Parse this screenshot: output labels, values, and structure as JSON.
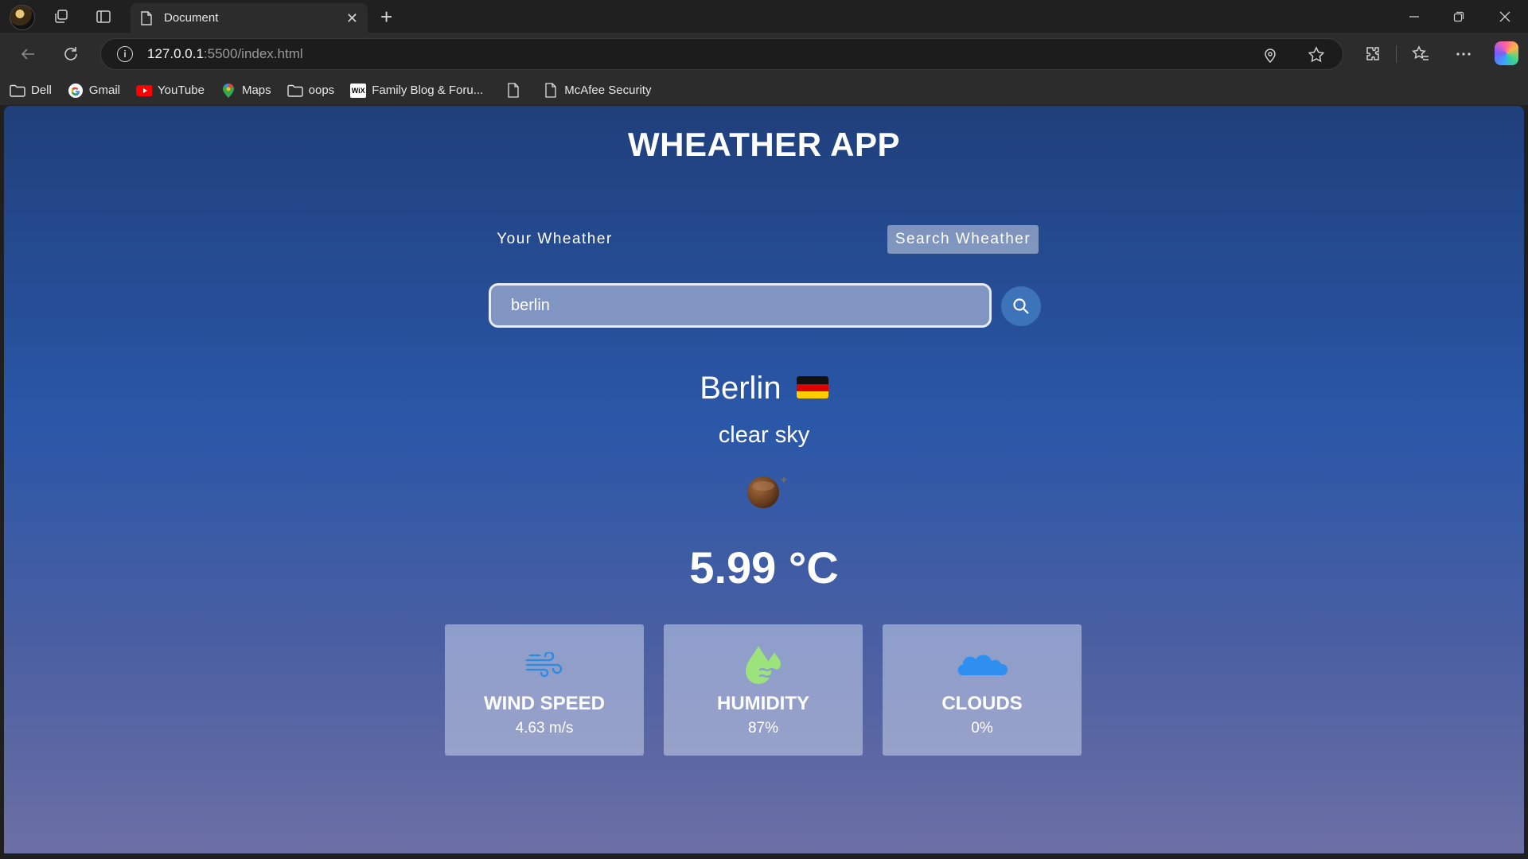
{
  "browser": {
    "tab_title": "Document",
    "address": {
      "host": "127.0.0.1",
      "path": ":5500/index.html"
    },
    "bookmarks": [
      {
        "label": "Dell",
        "icon": "folder-icon"
      },
      {
        "label": "Gmail",
        "icon": "google-icon"
      },
      {
        "label": "YouTube",
        "icon": "youtube-icon"
      },
      {
        "label": "Maps",
        "icon": "maps-pin-icon"
      },
      {
        "label": "oops",
        "icon": "folder-icon"
      },
      {
        "label": "Family Blog & Foru...",
        "icon": "wix-icon"
      },
      {
        "label": "",
        "icon": "page-icon"
      },
      {
        "label": "McAfee Security",
        "icon": "page-icon"
      }
    ]
  },
  "app": {
    "title": "WHEATHER APP",
    "tabs": {
      "your": "Your Wheather",
      "search": "Search Wheather"
    },
    "search": {
      "value": "berlin",
      "placeholder": ""
    },
    "weather": {
      "city": "Berlin",
      "country_flag": "germany-flag-icon",
      "description": "clear sky",
      "icon": "clear-sky-night-icon",
      "temperature": "5.99 °C"
    },
    "cards": [
      {
        "title": "WIND SPEED",
        "value": "4.63 m/s",
        "icon": "wind-icon"
      },
      {
        "title": "HUMIDITY",
        "value": "87%",
        "icon": "humidity-drop-icon"
      },
      {
        "title": "CLOUDS",
        "value": "0%",
        "icon": "cloud-icon"
      }
    ]
  },
  "colors": {
    "bg_top": "#203f7b",
    "bg_bottom": "#6c6fa4",
    "search_button": "#3d73b8",
    "wind_icon": "#2f8be0",
    "humidity_icon": "#9be37a",
    "cloud_icon": "#2e8ff0"
  }
}
